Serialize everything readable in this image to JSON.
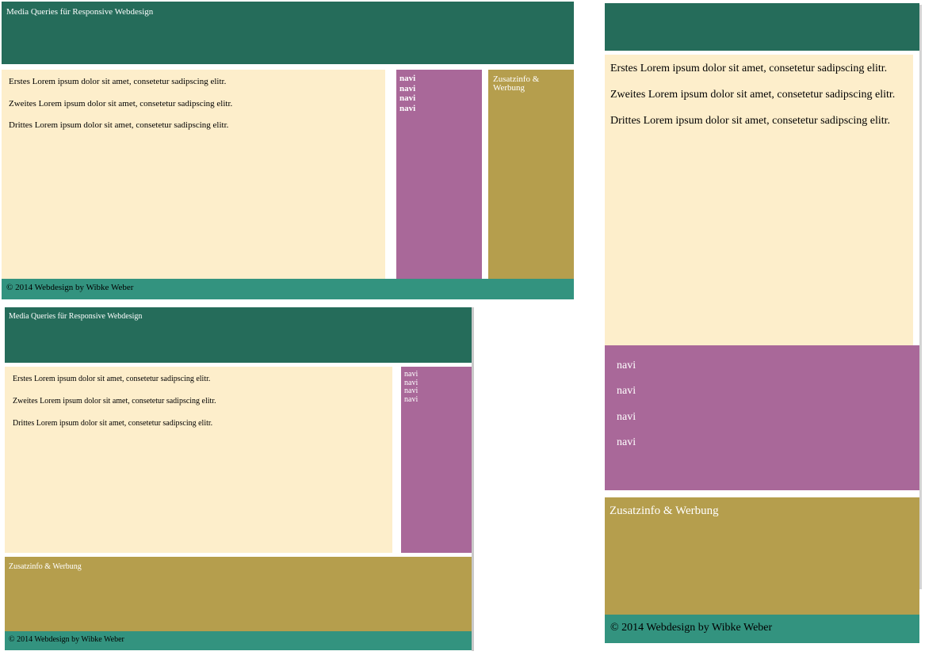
{
  "site": {
    "header_title": "Media Queries für Responsive Webdesign",
    "paragraphs": [
      "Erstes Lorem ipsum dolor sit amet, consetetur sadipscing elitr.",
      "Zweites Lorem ipsum dolor sit amet, consetetur sadipscing elitr.",
      "Drittes Lorem ipsum dolor sit amet, consetetur sadipscing elitr."
    ],
    "nav_items": [
      "navi",
      "navi",
      "navi",
      "navi"
    ],
    "aside_text": "Zusatzinfo & Werbung",
    "footer_text": "© 2014 Webdesign by Wibke Weber"
  },
  "colors": {
    "header": "#256c5a",
    "content": "#fdeecb",
    "nav": "#a96899",
    "aside": "#b59e4d",
    "footer": "#33937f"
  }
}
